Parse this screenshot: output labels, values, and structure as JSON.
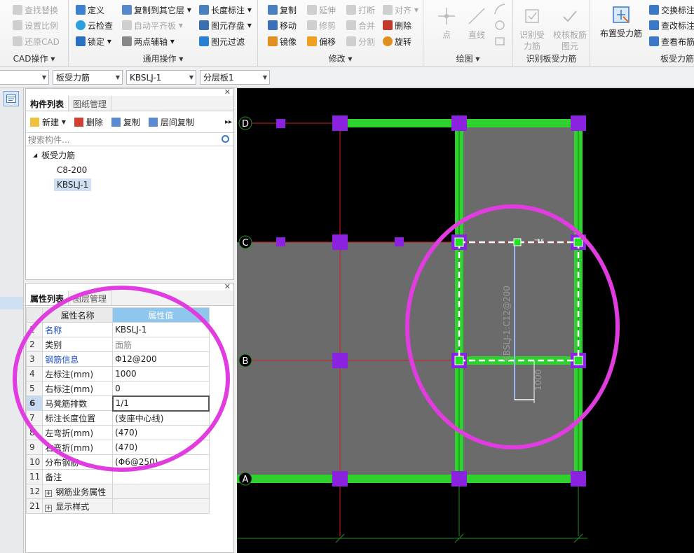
{
  "ribbon": {
    "cad": {
      "label": "CAD操作",
      "items": [
        "查找替换",
        "设置比例",
        "还原CAD"
      ]
    },
    "common": {
      "label": "通用操作",
      "items": [
        "定义",
        "云检查",
        "锁定",
        "复制到其它层",
        "自动平齐板",
        "两点辅轴",
        "长度标注",
        "图元存盘",
        "图元过滤"
      ]
    },
    "modify": {
      "label": "修改",
      "items": [
        "复制",
        "移动",
        "镜像",
        "延伸",
        "修剪",
        "偏移",
        "打断",
        "合并",
        "分割",
        "对齐",
        "删除",
        "旋转"
      ]
    },
    "draw": {
      "label": "绘图",
      "items": [
        "点",
        "直线"
      ]
    },
    "identify": {
      "label": "识别板受力筋",
      "items": [
        "识别受力筋",
        "校核板筋图元"
      ]
    },
    "layout": {
      "label": "板受力筋",
      "big": "布置受力筋",
      "items": [
        "交换标注",
        "查改标注",
        "查看布筋"
      ]
    }
  },
  "toolbar": {
    "combo0": "",
    "combo1": "板受力筋",
    "combo2": "KBSLJ-1",
    "combo3": "分层板1"
  },
  "component_panel": {
    "tabs": [
      "构件列表",
      "图纸管理"
    ],
    "new": "新建",
    "delete": "删除",
    "copy": "复制",
    "floor_copy": "层间复制",
    "search_placeholder": "搜索构件...",
    "tree_root": "板受力筋",
    "tree_items": [
      "C8-200",
      "KBSLJ-1"
    ]
  },
  "property_panel": {
    "tabs": [
      "属性列表",
      "图层管理"
    ],
    "header_name": "属性名称",
    "header_value": "属性值",
    "rows": [
      {
        "no": "1",
        "name": "名称",
        "value": "KBSLJ-1"
      },
      {
        "no": "2",
        "name": "类别",
        "value": "面筋"
      },
      {
        "no": "3",
        "name": "钢筋信息",
        "value": "Φ12@200"
      },
      {
        "no": "4",
        "name": "左标注(mm)",
        "value": "1000"
      },
      {
        "no": "5",
        "name": "右标注(mm)",
        "value": "0"
      },
      {
        "no": "6",
        "name": "马凳筋排数",
        "value": "1/1"
      },
      {
        "no": "7",
        "name": "标注长度位置",
        "value": "(支座中心线)"
      },
      {
        "no": "8",
        "name": "左弯折(mm)",
        "value": "(470)"
      },
      {
        "no": "9",
        "name": "右弯折(mm)",
        "value": "(470)"
      },
      {
        "no": "10",
        "name": "分布钢筋",
        "value": "(Φ6@250)"
      },
      {
        "no": "11",
        "name": "备注",
        "value": ""
      },
      {
        "no": "12",
        "name": "钢筋业务属性",
        "value": ""
      },
      {
        "no": "21",
        "name": "显示样式",
        "value": ""
      }
    ]
  },
  "canvas": {
    "axes": [
      "D",
      "C",
      "B",
      "A"
    ],
    "rebar_label": "KBSLJ-1:C12@200",
    "dim_label": "1000",
    "colors": {
      "beam": "#2fd12f",
      "slab": "#6b6b6b",
      "column": "#8b22e0",
      "axis": "#d42020",
      "highlight": "#e03ce0"
    }
  }
}
